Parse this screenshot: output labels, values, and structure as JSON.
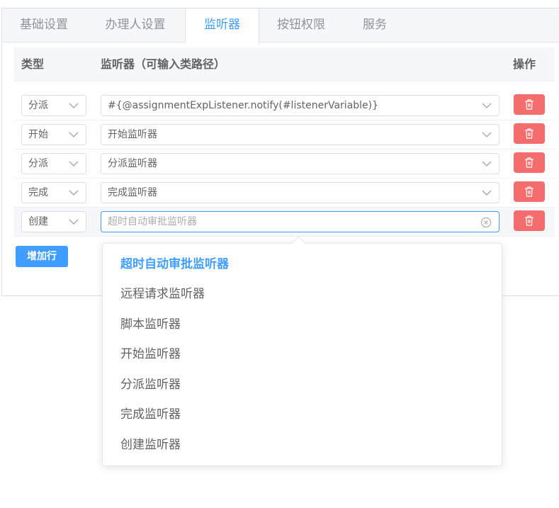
{
  "tabs": [
    "基础设置",
    "办理人设置",
    "监听器",
    "按钮权限",
    "服务"
  ],
  "active_tab": "监听器",
  "table": {
    "headers": {
      "type": "类型",
      "listener": "监听器（可输入类路径）",
      "action": "操作"
    },
    "rows": [
      {
        "type": "分派",
        "listener": "#{@assignmentExpListener.notify(#listenerVariable)}"
      },
      {
        "type": "开始",
        "listener": "开始监听器"
      },
      {
        "type": "分派",
        "listener": "分派监听器"
      },
      {
        "type": "完成",
        "listener": "完成监听器"
      },
      {
        "type": "创建",
        "listener_placeholder": "超时自动审批监听器"
      }
    ]
  },
  "add_row_label": "增加行",
  "dropdown": {
    "options": [
      "超时自动审批监听器",
      "远程请求监听器",
      "脚本监听器",
      "开始监听器",
      "分派监听器",
      "完成监听器",
      "创建监听器"
    ],
    "selected": "超时自动审批监听器"
  },
  "icons": {
    "chevron": "chevron-down-icon",
    "clear": "circle-close-icon",
    "delete": "trash-icon"
  },
  "colors": {
    "primary": "#409eff",
    "danger": "#f56c6c",
    "text": "#606266",
    "muted": "#909399"
  }
}
